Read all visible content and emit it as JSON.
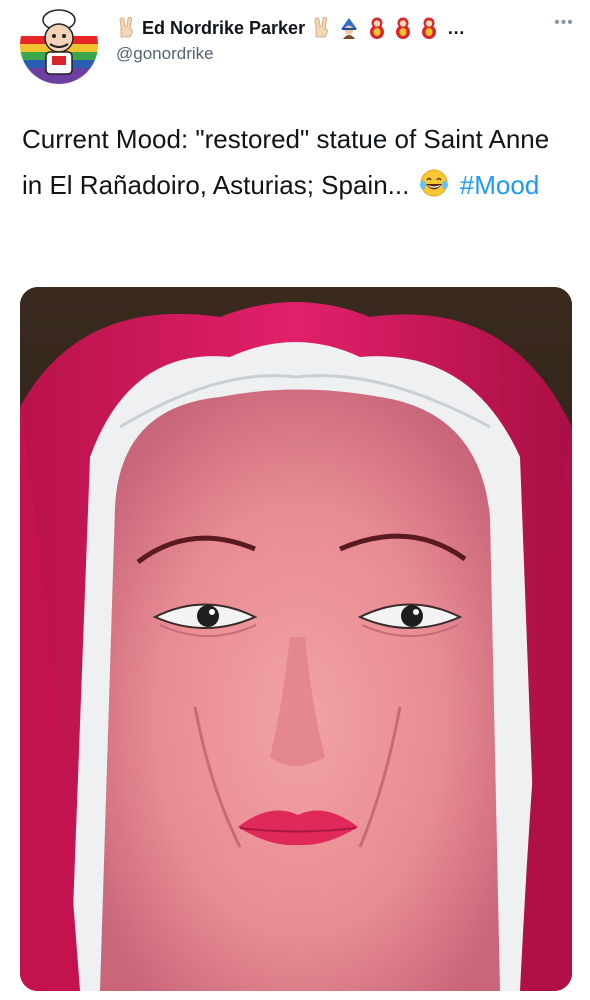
{
  "author": {
    "display_name": "Ed Nordrike Parker",
    "name_truncation": "…",
    "handle": "@gonordrike",
    "name_emojis": [
      "rock-on-hand-emoji",
      "rock-on-hand-emoji",
      "mage-emoji",
      "nesting-doll-emoji",
      "nesting-doll-emoji",
      "nesting-doll-emoji"
    ]
  },
  "menu": {
    "more_label": "•••"
  },
  "tweet": {
    "text_main": "Current Mood: \"restored\" statue of Saint Anne in El Rañadoiro, Asturias; Spain...",
    "emoji": "laughing-with-tears-emoji",
    "hashtag": "#Mood"
  },
  "colors": {
    "hashtag": "#1d9bf0",
    "text": "#0f1419",
    "secondary": "#536471"
  }
}
